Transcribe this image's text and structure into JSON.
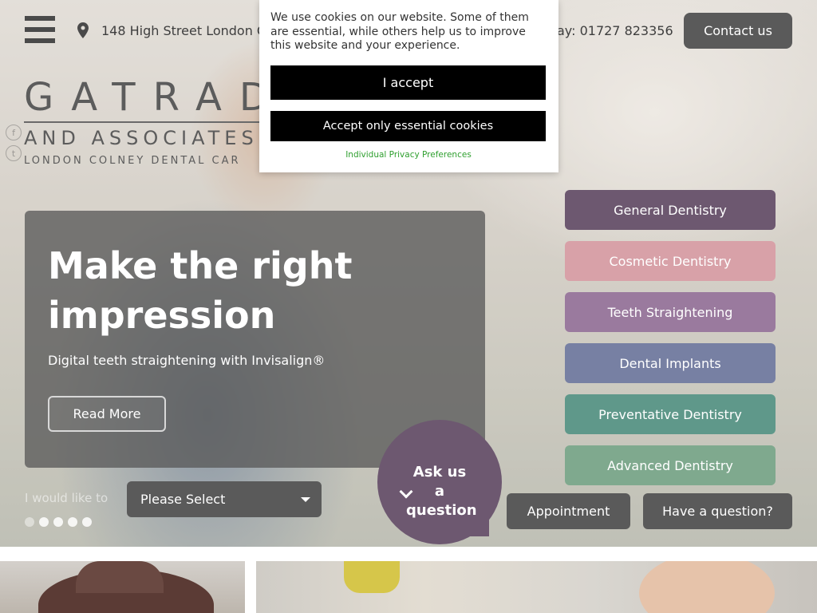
{
  "header": {
    "address": "148 High Street   London C",
    "phone": "ay: 01727 823356",
    "contact_label": "Contact us"
  },
  "logo": {
    "line1": "GATRAD",
    "line2": "AND ASSOCIATES",
    "line3": "LONDON COLNEY DENTAL CAR"
  },
  "cookie": {
    "message": "We use cookies on our website. Some of them are essential, while others help us to improve this website and your experience.",
    "accept_label": "I accept",
    "essential_label": "Accept only essential cookies",
    "preferences_label": "Individual Privacy Preferences"
  },
  "hero": {
    "title": "Make the right impression",
    "subtitle": "Digital teeth straightening with Invisalign®",
    "read_more_label": "Read More"
  },
  "form": {
    "label": "I would like to",
    "select_value": "Please Select"
  },
  "ask": {
    "label": "Ask us a question"
  },
  "services": [
    {
      "label": "General Dentistry",
      "color": "#6d5870"
    },
    {
      "label": "Cosmetic Dentistry",
      "color": "#d8a1a8"
    },
    {
      "label": "Teeth Straightening",
      "color": "#9a7a9e"
    },
    {
      "label": "Dental Implants",
      "color": "#7780a3"
    },
    {
      "label": "Preventative Dentistry",
      "color": "#5f988a"
    },
    {
      "label": "Advanced Dentistry",
      "color": "#7fa98e"
    }
  ],
  "actions": {
    "appointment_label": "Appointment",
    "question_label": "Have a question?"
  },
  "slider": {
    "count": 5,
    "active_index": 0
  }
}
